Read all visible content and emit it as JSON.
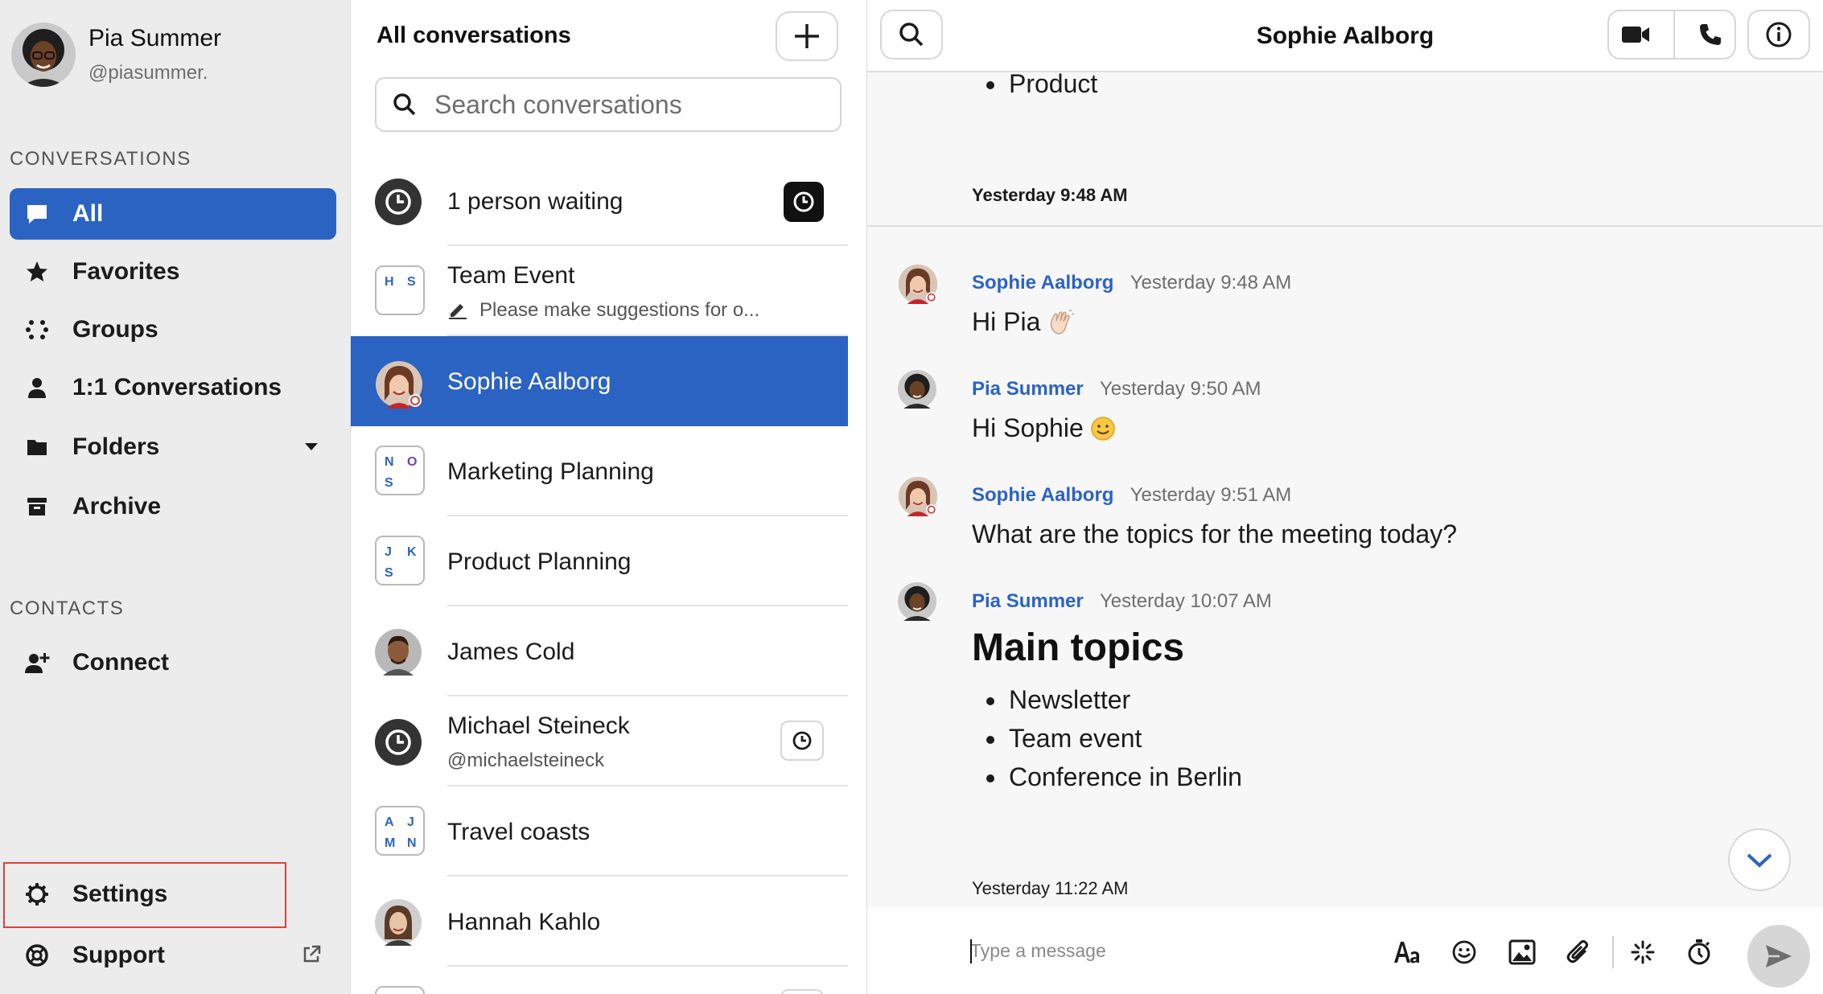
{
  "profile": {
    "name": "Pia Summer",
    "handle": "@piasummer."
  },
  "sidebar": {
    "conversations_title": "CONVERSATIONS",
    "items": [
      {
        "label": "All",
        "icon": "chat-bubble-icon",
        "active": true
      },
      {
        "label": "Favorites",
        "icon": "star-icon"
      },
      {
        "label": "Groups",
        "icon": "groups-dots-icon"
      },
      {
        "label": "1:1 Conversations",
        "icon": "person-icon"
      },
      {
        "label": "Folders",
        "icon": "folder-icon"
      },
      {
        "label": "Archive",
        "icon": "archive-icon"
      }
    ],
    "contacts_title": "CONTACTS",
    "connect_label": "Connect",
    "settings_label": "Settings",
    "support_label": "Support"
  },
  "convlist": {
    "title": "All conversations",
    "search_placeholder": "Search conversations",
    "items": [
      {
        "title": "1 person waiting"
      },
      {
        "title": "Team Event",
        "subtitle": "Please make suggestions for o...",
        "initials": [
          "H",
          "S"
        ]
      },
      {
        "title": "Sophie Aalborg"
      },
      {
        "title": "Marketing Planning",
        "initials": [
          "N",
          "O",
          "S"
        ]
      },
      {
        "title": "Product Planning",
        "initials": [
          "J",
          "K",
          "S"
        ]
      },
      {
        "title": "James Cold"
      },
      {
        "title": "Michael Steineck",
        "subtitle": "@michaelsteineck"
      },
      {
        "title": "Travel coasts",
        "initials": [
          "A",
          "J",
          "M",
          "N"
        ]
      },
      {
        "title": "Hannah Kahlo"
      }
    ]
  },
  "chat": {
    "title": "Sophie Aalborg",
    "top_bullet": "Product",
    "day_separator_1": "Yesterday 9:48 AM",
    "messages": [
      {
        "author": "Sophie Aalborg",
        "time": "Yesterday 9:48 AM",
        "text": "Hi Pia"
      },
      {
        "author": "Pia Summer",
        "time": "Yesterday 9:50 AM",
        "text": "Hi Sophie"
      },
      {
        "author": "Sophie Aalborg",
        "time": "Yesterday 9:51 AM",
        "text": "What are the topics for the meeting today?"
      },
      {
        "author": "Pia Summer",
        "time": "Yesterday 10:07 AM",
        "heading": "Main topics",
        "bullets": [
          "Newsletter",
          "Team event",
          "Conference in Berlin"
        ]
      }
    ],
    "day_separator_2": "Yesterday 11:22 AM",
    "composer_placeholder": "Type a message"
  },
  "colors": {
    "accent": "#2b63c3",
    "sidebar_bg": "#ececec",
    "chat_bg": "#f7f7f7",
    "highlight_border": "#d9433b"
  }
}
